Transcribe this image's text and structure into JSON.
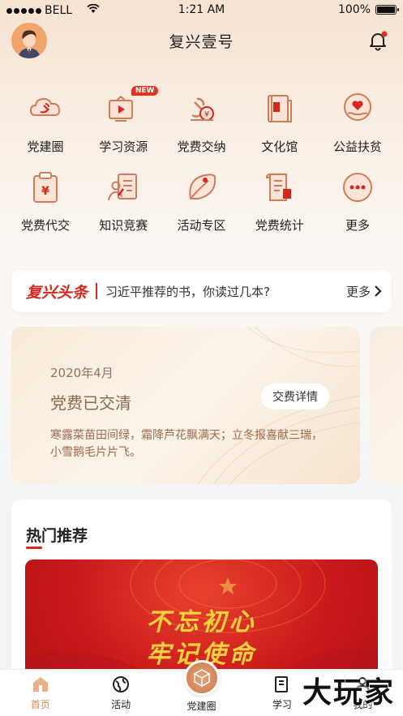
{
  "status_bar": {
    "carrier": "BELL",
    "time": "1:21 AM",
    "battery": "100%",
    "battery_level": 1.0
  },
  "header": {
    "title": "复兴壹号",
    "notification_badge_color": "#e03423"
  },
  "grid": [
    {
      "label": "党建圈",
      "icon": "party-circle-icon"
    },
    {
      "label": "学习资源",
      "icon": "video-play-icon",
      "badge": "NEW"
    },
    {
      "label": "党费交纳",
      "icon": "fee-payment-icon"
    },
    {
      "label": "文化馆",
      "icon": "book-icon"
    },
    {
      "label": "公益扶贫",
      "icon": "heart-hand-icon"
    },
    {
      "label": "党费代交",
      "icon": "clipboard-yen-icon"
    },
    {
      "label": "知识竞赛",
      "icon": "quiz-icon"
    },
    {
      "label": "活动专区",
      "icon": "leaf-icon"
    },
    {
      "label": "党费统计",
      "icon": "statistics-icon"
    },
    {
      "label": "更多",
      "icon": "more-dots-icon"
    }
  ],
  "headline": {
    "brand": "复兴头条",
    "news": "习近平推荐的书，你读过几本?",
    "more": "更多"
  },
  "fee_card": {
    "date": "2020年4月",
    "status": "党费已交清",
    "detail_button": "交费详情",
    "poem": "寒露菜苗田间绿，霜降芦花飘满天；立冬报喜献三瑞，小雪鹅毛片片飞。"
  },
  "hot": {
    "title": "热门推荐",
    "banner_line1": "不忘初心",
    "banner_line2": "牢记使命"
  },
  "tabbar": [
    {
      "label": "首页",
      "icon": "home-icon",
      "active": true
    },
    {
      "label": "活动",
      "icon": "globe-icon",
      "active": false
    },
    {
      "label": "党建圈",
      "icon": "cube-icon",
      "active": false
    },
    {
      "label": "学习",
      "icon": "study-icon",
      "active": false
    },
    {
      "label": "我的",
      "icon": "profile-icon",
      "active": false
    }
  ],
  "watermark": "大玩家",
  "colors": {
    "accent_red": "#d8261c",
    "icon_orange": "#cf7d56",
    "tab_active": "#d98a52"
  }
}
